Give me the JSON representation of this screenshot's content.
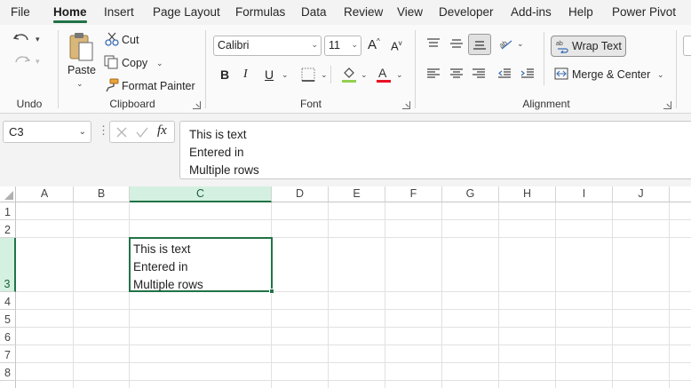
{
  "tabs": [
    "File",
    "Home",
    "Insert",
    "Page Layout",
    "Formulas",
    "Data",
    "Review",
    "View",
    "Developer",
    "Add-ins",
    "Help",
    "Power Pivot"
  ],
  "active_tab": "Home",
  "ribbon": {
    "undo": {
      "group_label": "Undo"
    },
    "clipboard": {
      "group_label": "Clipboard",
      "paste_label": "Paste",
      "cut_label": "Cut",
      "copy_label": "Copy",
      "format_painter_label": "Format Painter"
    },
    "font": {
      "group_label": "Font",
      "font_name": "Calibri",
      "font_size": "11",
      "bold": "B",
      "italic": "I",
      "underline": "U",
      "font_color": "#e81123",
      "fill_color": "#92d050"
    },
    "alignment": {
      "group_label": "Alignment",
      "wrap_text_label": "Wrap Text",
      "merge_label": "Merge & Center"
    }
  },
  "formula_bar": {
    "name_box": "C3",
    "fx_label": "fx",
    "lines": [
      "This is text",
      "Entered in",
      "Multiple rows"
    ]
  },
  "sheet": {
    "columns": [
      "A",
      "B",
      "C",
      "D",
      "E",
      "F",
      "G",
      "H",
      "I",
      "J"
    ],
    "selected_column": "C",
    "rows": [
      "1",
      "2",
      "3",
      "4",
      "5",
      "6",
      "7",
      "8"
    ],
    "selected_row": "3",
    "cell_C3_lines": [
      "This is text",
      "Entered in",
      "Multiple rows"
    ]
  },
  "accent_color": "#217346"
}
